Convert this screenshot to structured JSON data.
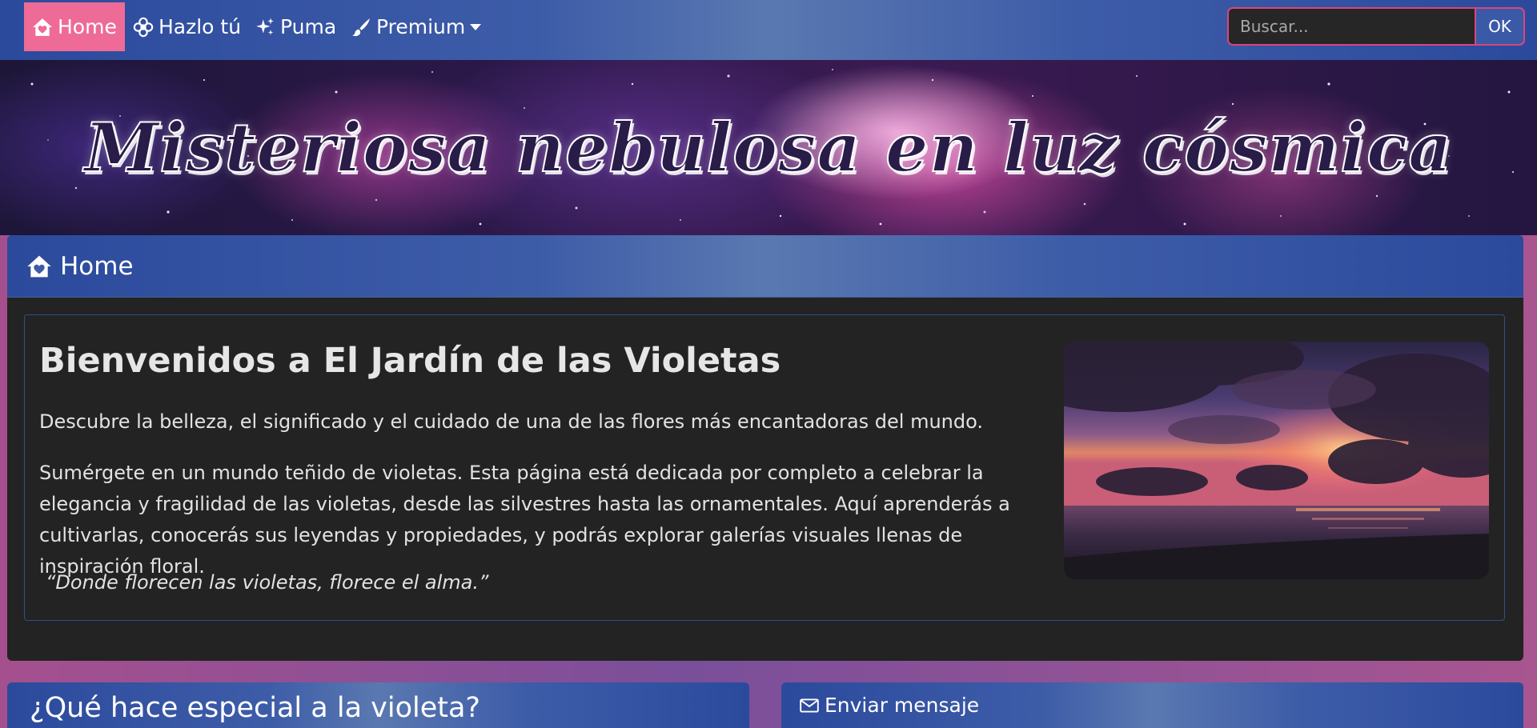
{
  "nav": {
    "items": [
      {
        "label": "Home",
        "icon": "house-heart-icon",
        "active": true
      },
      {
        "label": "Hazlo tú",
        "icon": "flower-icon",
        "active": false
      },
      {
        "label": "Puma",
        "icon": "sparkles-icon",
        "active": false
      },
      {
        "label": "Premium",
        "icon": "brush-icon",
        "active": false,
        "dropdown": true
      }
    ],
    "search": {
      "placeholder": "Buscar...",
      "value": "",
      "button_label": "OK"
    }
  },
  "banner": {
    "title": "Misteriosa nebulosa en luz cósmica"
  },
  "main": {
    "header": {
      "title": "Home",
      "icon": "house-heart-icon"
    },
    "welcome": {
      "title": "Bienvenidos a El Jardín de las Violetas",
      "lead": "Descubre la belleza, el significado y el cuidado de una de las flores más encantadoras del mundo.",
      "body": "Sumérgete en un mundo teñido de violetas. Esta página está dedicada por completo a celebrar la elegancia y fragilidad de las violetas, desde las silvestres hasta las ornamentales. Aquí aprenderás a cultivarlas, conocerás sus leyendas y propiedades, y podrás explorar galerías visuales llenas de inspiración floral.",
      "quote": "“Donde florecen las violetas, florece el alma.”"
    }
  },
  "panels": {
    "left": {
      "title": "¿Qué hace especial a la violeta?"
    },
    "right": {
      "title": "Enviar mensaje",
      "icon": "envelope-icon"
    }
  },
  "colors": {
    "nav_active": "#ee6b97",
    "nav_bg": "#3d5ca8",
    "card_bg": "#232323",
    "page_bg": "#a5508e",
    "search_border": "#d8467f"
  }
}
